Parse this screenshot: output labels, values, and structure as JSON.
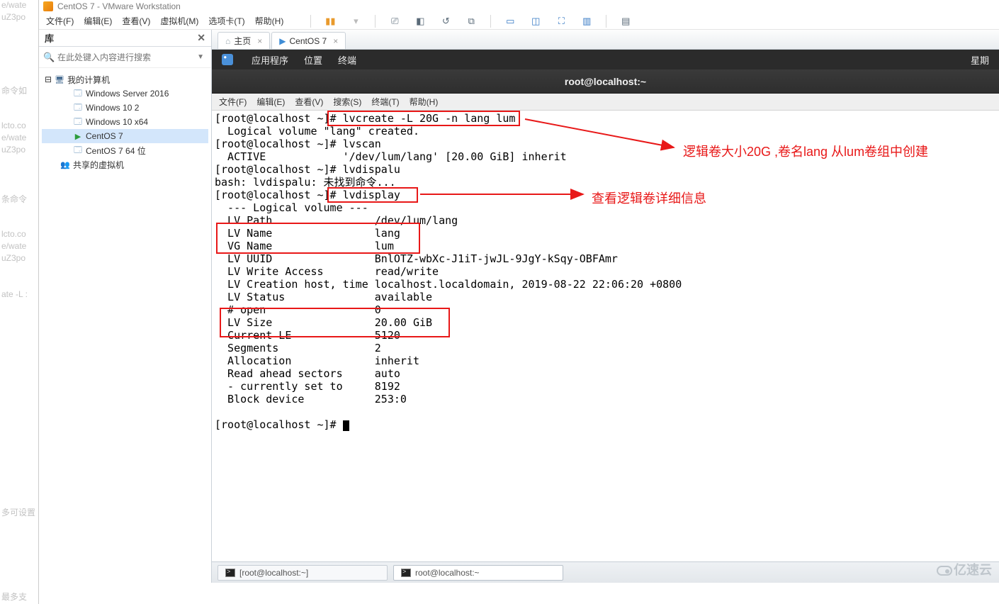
{
  "gutter_lines": [
    "e/wate",
    "uZ3po",
    "",
    "",
    "",
    "",
    "",
    "命令如",
    "",
    "",
    "lcto.co",
    "e/wate",
    "uZ3po",
    "",
    "",
    "",
    "条命令",
    "",
    "",
    "lcto.co",
    "e/wate",
    "uZ3po",
    "",
    "",
    "ate -L :",
    "",
    "",
    "",
    "",
    "",
    "",
    "",
    "",
    "",
    "",
    "",
    "",
    "",
    "",
    "",
    "",
    "",
    "多可设置",
    "",
    "",
    "",
    "",
    "",
    "",
    "最多支"
  ],
  "title": "CentOS 7 - VMware Workstation",
  "menu": [
    "文件(F)",
    "编辑(E)",
    "查看(V)",
    "虚拟机(M)",
    "选项卡(T)",
    "帮助(H)"
  ],
  "sidebar": {
    "title": "库",
    "search_placeholder": "在此处键入内容进行搜索",
    "nodes": {
      "root": "我的计算机",
      "items": [
        "Windows Server 2016",
        "Windows 10 2",
        "Windows 10 x64",
        "CentOS 7",
        "CentOS 7 64 位"
      ],
      "shared": "共享的虚拟机"
    }
  },
  "tabs": {
    "home": "主页",
    "vm": "CentOS 7"
  },
  "gnome": {
    "apps": "应用程序",
    "places": "位置",
    "term": "终端",
    "right": "星期"
  },
  "window_title": "root@localhost:~",
  "term_menu": [
    "文件(F)",
    "编辑(E)",
    "查看(V)",
    "搜索(S)",
    "终端(T)",
    "帮助(H)"
  ],
  "terminal_text": "[root@localhost ~]# lvcreate -L 20G -n lang lum\n  Logical volume \"lang\" created.\n[root@localhost ~]# lvscan\n  ACTIVE            '/dev/lum/lang' [20.00 GiB] inherit\n[root@localhost ~]# lvdispalu\nbash: lvdispalu: 未找到命令...\n[root@localhost ~]# lvdisplay\n  --- Logical volume ---\n  LV Path                /dev/lum/lang\n  LV Name                lang\n  VG Name                lum\n  LV UUID                BnlOTZ-wbXc-J1iT-jwJL-9JgY-kSqy-OBFAmr\n  LV Write Access        read/write\n  LV Creation host, time localhost.localdomain, 2019-08-22 22:06:20 +0800\n  LV Status              available\n  # open                 0\n  LV Size                20.00 GiB\n  Current LE             5120\n  Segments               2\n  Allocation             inherit\n  Read ahead sectors     auto\n  - currently set to     8192\n  Block device           253:0\n\n[root@localhost ~]# ",
  "annotations": {
    "line1": "逻辑卷大小20G ,卷名lang 从lum卷组中创建",
    "line2": "查看逻辑卷详细信息"
  },
  "taskbar": {
    "item1": "[root@localhost:~]",
    "item2": "root@localhost:~"
  },
  "watermark": "亿速云"
}
